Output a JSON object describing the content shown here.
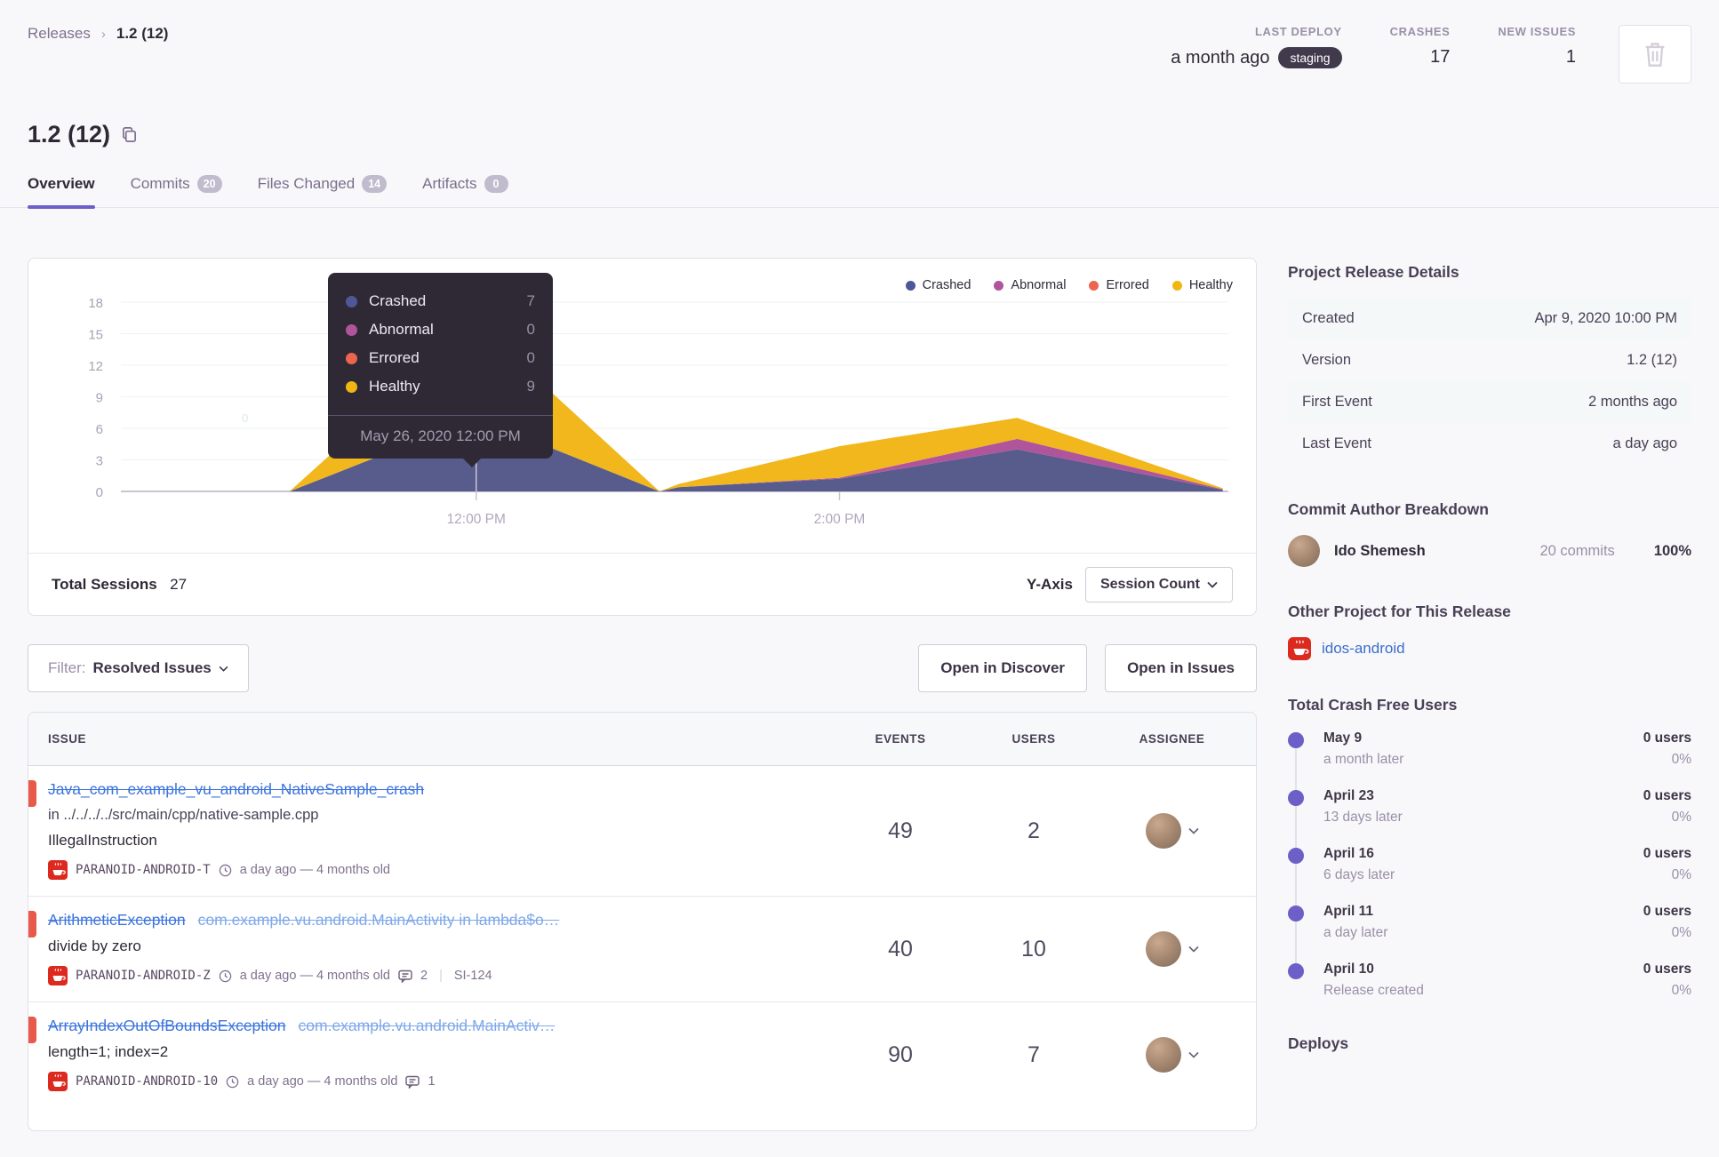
{
  "header": {
    "breadcrumb": {
      "root": "Releases",
      "current": "1.2 (12)"
    },
    "title": "1.2 (12)",
    "stats": {
      "last_deploy": {
        "label": "LAST DEPLOY",
        "value": "a month ago",
        "env": "staging"
      },
      "crashes": {
        "label": "CRASHES",
        "value": "17"
      },
      "new_issues": {
        "label": "NEW ISSUES",
        "value": "1"
      }
    }
  },
  "tabs": [
    {
      "label": "Overview"
    },
    {
      "label": "Commits",
      "badge": "20"
    },
    {
      "label": "Files Changed",
      "badge": "14"
    },
    {
      "label": "Artifacts",
      "badge": "0"
    }
  ],
  "chart_data": {
    "type": "area",
    "stacked": true,
    "x_frac": [
      0,
      0.155,
      0.323,
      0.488,
      0.505,
      0.65,
      0.81,
      0.995
    ],
    "series": [
      {
        "name": "Crashed",
        "color": "#575c8c",
        "dot": "#4f5798",
        "values": [
          0,
          0,
          7,
          0,
          0.4,
          1.2,
          4,
          0.15
        ]
      },
      {
        "name": "Abnormal",
        "color": "#b0559b",
        "dot": "#b0559b",
        "values": [
          0,
          0,
          0,
          0,
          0,
          0.1,
          1,
          0.05
        ]
      },
      {
        "name": "Errored",
        "color": "#ec654e",
        "dot": "#ec654e",
        "values": [
          0,
          0,
          0,
          0,
          0,
          0,
          0,
          0
        ]
      },
      {
        "name": "Healthy",
        "color": "#f1b71c",
        "dot": "#f0b712",
        "values": [
          0,
          0,
          9,
          0,
          0.3,
          3,
          2,
          0.1
        ]
      }
    ],
    "y_ticks": [
      0,
      3,
      6,
      9,
      12,
      15,
      18
    ],
    "x_ticks": [
      {
        "label": "12:00 PM",
        "frac": 0.323
      },
      {
        "label": "2:00 PM",
        "frac": 0.65
      }
    ],
    "hover_frac": 0.323,
    "faint_label": {
      "text": "0",
      "frac": 0.115,
      "value": 6.6
    },
    "legend_position": "top-right",
    "ylim": [
      0,
      18
    ]
  },
  "tooltip": {
    "rows": [
      {
        "label": "Crashed",
        "value": "7"
      },
      {
        "label": "Abnormal",
        "value": "0"
      },
      {
        "label": "Errored",
        "value": "0"
      },
      {
        "label": "Healthy",
        "value": "9"
      }
    ],
    "date": "May 26, 2020 12:00 PM"
  },
  "chart_footer": {
    "total_sessions_label": "Total Sessions",
    "total_sessions_value": "27",
    "yaxis_label": "Y-Axis",
    "yaxis_value": "Session Count"
  },
  "filter": {
    "label": "Filter:",
    "value": "Resolved Issues"
  },
  "actions": {
    "discover": "Open in Discover",
    "issues": "Open in Issues"
  },
  "issues_table": {
    "columns": {
      "issue": "ISSUE",
      "events": "EVENTS",
      "users": "USERS",
      "assignee": "ASSIGNEE"
    },
    "rows": [
      {
        "title": "Java_com_example_vu_android_NativeSample_crash",
        "location": "in ../../../../src/main/cpp/native-sample.cpp",
        "subtitle": "IllegalInstruction",
        "project": "PARANOID-ANDROID-T",
        "age": "a day ago — 4 months old",
        "events": "49",
        "users": "2"
      },
      {
        "title": "ArithmeticException",
        "culprit": "com.example.vu.android.MainActivity in lambda$o…",
        "subtitle": "divide by zero",
        "project": "PARANOID-ANDROID-Z",
        "age": "a day ago — 4 months old",
        "comments": "2",
        "short_id": "SI-124",
        "events": "40",
        "users": "10"
      },
      {
        "title": "ArrayIndexOutOfBoundsException",
        "culprit": "com.example.vu.android.MainActiv…",
        "subtitle": "length=1; index=2",
        "project": "PARANOID-ANDROID-10",
        "age": "a day ago — 4 months old",
        "comments": "1",
        "events": "90",
        "users": "7"
      }
    ]
  },
  "sidebar": {
    "details": {
      "heading": "Project Release Details",
      "rows": [
        {
          "label": "Created",
          "value": "Apr 9, 2020 10:00 PM"
        },
        {
          "label": "Version",
          "value": "1.2 (12)"
        },
        {
          "label": "First Event",
          "value": "2 months ago"
        },
        {
          "label": "Last Event",
          "value": "a day ago"
        }
      ]
    },
    "commit_authors": {
      "heading": "Commit Author Breakdown",
      "author": {
        "name": "Ido Shemesh",
        "commits": "20 commits",
        "percent": "100%"
      }
    },
    "other_project": {
      "heading": "Other Project for This Release",
      "name": "idos-android"
    },
    "crash_free": {
      "heading": "Total Crash Free Users",
      "entries": [
        {
          "date": "May 9",
          "sub": "a month later",
          "users": "0 users",
          "percent": "0%"
        },
        {
          "date": "April 23",
          "sub": "13 days later",
          "users": "0 users",
          "percent": "0%"
        },
        {
          "date": "April 16",
          "sub": "6 days later",
          "users": "0 users",
          "percent": "0%"
        },
        {
          "date": "April 11",
          "sub": "a day later",
          "users": "0 users",
          "percent": "0%"
        },
        {
          "date": "April 10",
          "sub": "Release created",
          "users": "0 users",
          "percent": "0%"
        }
      ]
    },
    "deploys_heading": "Deploys"
  }
}
